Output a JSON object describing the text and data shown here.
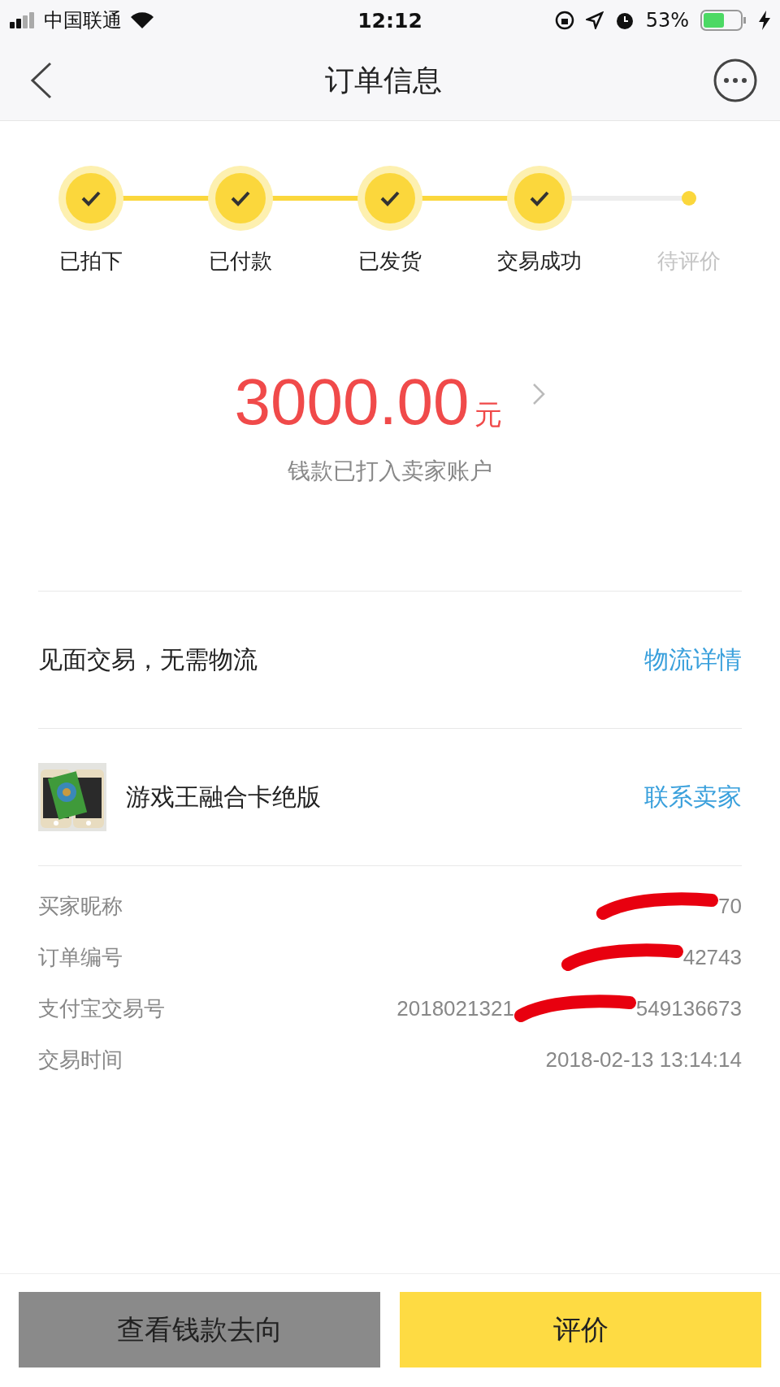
{
  "status_bar": {
    "carrier": "中国联通",
    "time": "12:12",
    "battery": "53%"
  },
  "nav": {
    "title": "订单信息"
  },
  "steps": [
    {
      "label": "已拍下",
      "done": true
    },
    {
      "label": "已付款",
      "done": true
    },
    {
      "label": "已发货",
      "done": true
    },
    {
      "label": "交易成功",
      "done": true
    },
    {
      "label": "待评价",
      "done": false
    }
  ],
  "amount": {
    "value": "3000.00",
    "unit": "元",
    "note": "钱款已打入卖家账户"
  },
  "logistics": {
    "text": "见面交易，无需物流",
    "link": "物流详情"
  },
  "product": {
    "kind": "picture",
    "name": "游戏王融合卡绝版",
    "link": "联系卖家"
  },
  "details": [
    {
      "label": "买家昵称",
      "parts": [
        {
          "kind": "redaction"
        },
        {
          "kind": "text",
          "text": "70"
        }
      ]
    },
    {
      "label": "订单编号",
      "parts": [
        {
          "kind": "redaction"
        },
        {
          "kind": "text",
          "text": "42743"
        }
      ]
    },
    {
      "label": "支付宝交易号",
      "parts": [
        {
          "kind": "text",
          "text": "2018021321"
        },
        {
          "kind": "redaction"
        },
        {
          "kind": "text",
          "text": "549136673"
        }
      ]
    },
    {
      "label": "交易时间",
      "parts": [
        {
          "kind": "text",
          "text": "2018-02-13 13:14:14"
        }
      ]
    }
  ],
  "buttons": [
    {
      "label": "查看钱款去向",
      "kind": "secondary"
    },
    {
      "label": "评价",
      "kind": "primary"
    }
  ]
}
